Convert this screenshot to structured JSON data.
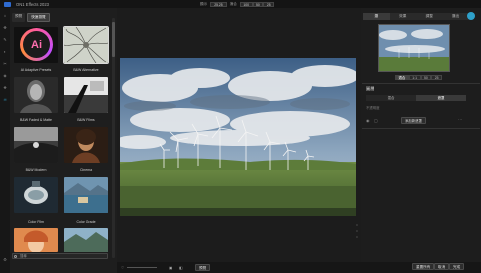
{
  "app": {
    "title": "ON1 Effects 2023"
  },
  "zoom": {
    "label": "顯示",
    "value": "25.25",
    "fit_label": "適合",
    "buttons": [
      "100",
      "50",
      "25"
    ]
  },
  "right_tabs": [
    "瀏",
    "效果",
    "調整",
    "匯出"
  ],
  "left_tools": [
    "⌂",
    "✥",
    "✎",
    "◐",
    "✂",
    "◈",
    "❖",
    "♒",
    "⚙"
  ],
  "preset_tabs": [
    "預覽",
    "快速瀏覽"
  ],
  "presets": [
    {
      "label": "AI Adaptive Presets"
    },
    {
      "label": "B&W Alternative"
    },
    {
      "label": "B&W Faded & Matte"
    },
    {
      "label": "B&W Films"
    },
    {
      "label": "B&W Modern"
    },
    {
      "label": "Cinema"
    },
    {
      "label": "Color Film"
    },
    {
      "label": "Color Grade"
    },
    {
      "label": ""
    },
    {
      "label": ""
    }
  ],
  "ai_tile_text": "Ai",
  "search": {
    "placeholder": "搜尋"
  },
  "navigator": {
    "buttons": [
      "適合",
      "1:1",
      "50",
      "25"
    ]
  },
  "panel": {
    "title": "圖層",
    "tabs": [
      "混合",
      "遮罩"
    ],
    "field_label": "不透明度",
    "add_button": "添加新遮罩"
  },
  "bottom": {
    "preview_button": "預覽",
    "left_icons": [
      "♡",
      "▣",
      "◧"
    ]
  },
  "footer_buttons": [
    "重置所有",
    "取消",
    "完成"
  ],
  "watermark": "www.MacZ.com"
}
